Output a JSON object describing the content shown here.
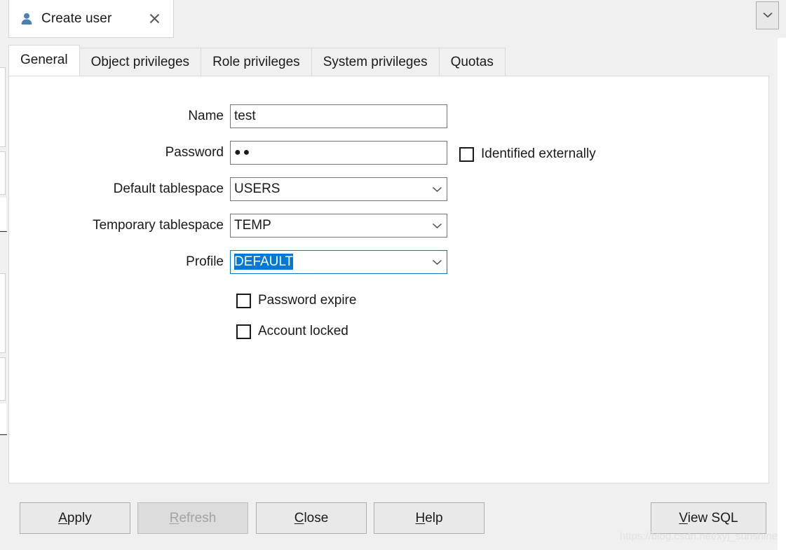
{
  "window": {
    "tab_title": "Create user",
    "tab_icon": "user-icon",
    "close_icon": "close-icon",
    "overflow_icon": "chevron-down-icon"
  },
  "tabs": [
    {
      "label": "General",
      "active": true
    },
    {
      "label": "Object privileges",
      "active": false
    },
    {
      "label": "Role privileges",
      "active": false
    },
    {
      "label": "System privileges",
      "active": false
    },
    {
      "label": "Quotas",
      "active": false
    }
  ],
  "form": {
    "name": {
      "label": "Name",
      "value": "test"
    },
    "password": {
      "label": "Password",
      "value": "●●"
    },
    "identified_externally": {
      "label": "Identified externally",
      "checked": false
    },
    "default_tablespace": {
      "label": "Default tablespace",
      "value": "USERS"
    },
    "temporary_tablespace": {
      "label": "Temporary tablespace",
      "value": "TEMP"
    },
    "profile": {
      "label": "Profile",
      "value": "DEFAULT",
      "focused": true
    },
    "password_expire": {
      "label": "Password expire",
      "checked": false
    },
    "account_locked": {
      "label": "Account locked",
      "checked": false
    }
  },
  "footer": {
    "apply": {
      "mnemonic": "A",
      "rest": "pply"
    },
    "refresh": {
      "mnemonic": "R",
      "rest": "efresh",
      "disabled": true
    },
    "close": {
      "mnemonic": "C",
      "rest": "lose"
    },
    "help": {
      "mnemonic": "H",
      "rest": "elp"
    },
    "view_sql": {
      "mnemonic": "V",
      "rest": "iew SQL"
    }
  },
  "watermark": "https://blog.csdn.net/xyj_sunshine",
  "colors": {
    "accent": "#0078d7",
    "dialog_bg": "#f0f0f0",
    "panel_bg": "#ffffff",
    "field_border": "#767676"
  }
}
